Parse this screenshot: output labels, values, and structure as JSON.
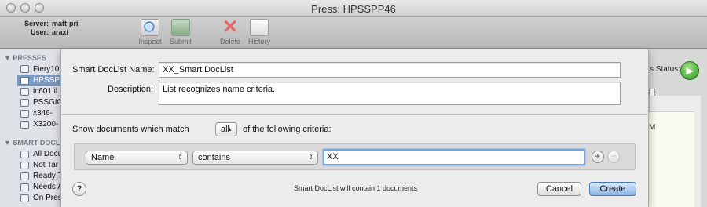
{
  "window": {
    "title": "Press: HPSSPP46"
  },
  "toolbar": {
    "server_label": "Server:",
    "server_value": "matt-pri",
    "user_label": "User:",
    "user_value": "araxi",
    "buttons": [
      {
        "label": "Inspect",
        "icon": "inspect-icon"
      },
      {
        "label": "Submit",
        "icon": "submit-icon"
      },
      {
        "label": "Delete",
        "icon": "delete-icon"
      },
      {
        "label": "History",
        "icon": "history-icon"
      }
    ]
  },
  "sidebar": {
    "presses_header": "▼ PRESSES",
    "presses": [
      "Fiery10",
      "HPSSP",
      "ic601.il",
      "PSSGIO",
      "x346-",
      "X3200-"
    ],
    "smart_header": "▼ SMART DOCL",
    "smart_items": [
      "All Docu",
      "Not Tar",
      "Ready T",
      "Needs A",
      "On Pres"
    ]
  },
  "background": {
    "status_label": "s Status:",
    "list_text": "M"
  },
  "sheet": {
    "name_label": "Smart DocList Name:",
    "name_value": "XX_Smart DocList",
    "description_label": "Description:",
    "description_value": "List recognizes name criteria.",
    "match_prefix": "Show documents which match",
    "match_value": "all",
    "match_suffix": "of the following criteria:",
    "criteria": {
      "field": "Name",
      "operator": "contains",
      "value": "XX"
    },
    "add_symbol": "+",
    "remove_symbol": "−",
    "help_symbol": "?",
    "message": "Smart DocList will contain 1 documents",
    "cancel_label": "Cancel",
    "create_label": "Create"
  },
  "colors": {
    "accent": "#76a5dd",
    "selection": "#7b9ac3",
    "go_green": "#2e9a1f"
  }
}
